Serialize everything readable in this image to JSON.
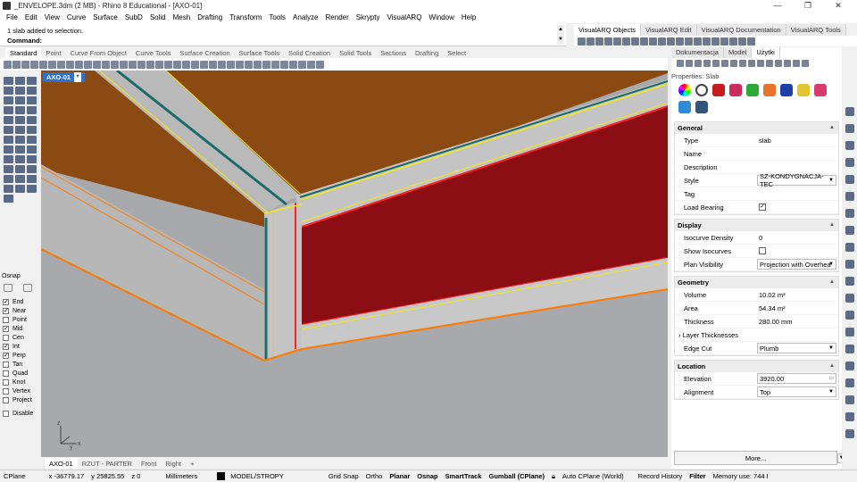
{
  "window": {
    "title": "_ENVELOPE.3dm (2 MB) - Rhino 8 Educational - [AXO-01]",
    "buttons": [
      "—",
      "❐",
      "✕"
    ]
  },
  "menu": [
    "File",
    "Edit",
    "View",
    "Curve",
    "Surface",
    "SubD",
    "Solid",
    "Mesh",
    "Drafting",
    "Transform",
    "Tools",
    "Analyze",
    "Render",
    "Skrypty",
    "VisualARQ",
    "Window",
    "Help"
  ],
  "command": {
    "history": "1 slab added to selection.",
    "prompt": "Command:"
  },
  "right_top_tabs": [
    "VisualARQ Objects",
    "VisualARQ Edit",
    "VisualARQ Documentation",
    "VisualARQ Tools"
  ],
  "toolbar_tabs": [
    "Standard",
    "Point",
    "Curve From Object",
    "Curve Tools",
    "Surface Creation",
    "Surface Tools",
    "Solid Creation",
    "Solid Tools",
    "Sections",
    "Drafting",
    "Select"
  ],
  "viewport": {
    "label": "AXO-01",
    "tabs": [
      "AXO-01",
      "RZUT - PARTER",
      "Front",
      "Right",
      "+"
    ],
    "axes": {
      "x": "x",
      "y": "y",
      "z": "z"
    }
  },
  "osnap": {
    "title": "Osnap",
    "items": [
      {
        "label": "End",
        "checked": true
      },
      {
        "label": "Near",
        "checked": true
      },
      {
        "label": "Point",
        "checked": false
      },
      {
        "label": "Mid",
        "checked": true
      },
      {
        "label": "Cen",
        "checked": false
      },
      {
        "label": "Int",
        "checked": true
      },
      {
        "label": "Perp",
        "checked": true
      },
      {
        "label": "Tan",
        "checked": false
      },
      {
        "label": "Quad",
        "checked": false
      },
      {
        "label": "Knot",
        "checked": false
      },
      {
        "label": "Vertex",
        "checked": false
      },
      {
        "label": "Project",
        "checked": false
      }
    ],
    "disable": "Disable"
  },
  "panel": {
    "tabs": [
      "Dokumentacja",
      "Model",
      "Użytki"
    ],
    "title": "Properties: Slab",
    "general": {
      "title": "General",
      "rows": [
        {
          "label": "Type",
          "value": "slab"
        },
        {
          "label": "Name",
          "value": ""
        },
        {
          "label": "Description",
          "value": ""
        },
        {
          "label": "Style",
          "value": "SZ-KONDYGNACJA-TEC"
        },
        {
          "label": "Tag",
          "value": ""
        },
        {
          "label": "Load Bearing",
          "value": "✓"
        }
      ]
    },
    "display": {
      "title": "Display",
      "rows": [
        {
          "label": "Isocurve Density",
          "value": "0"
        },
        {
          "label": "Show Isocurves",
          "value": ""
        },
        {
          "label": "Plan Visibility",
          "value": "Projection with Overhea"
        }
      ]
    },
    "geometry": {
      "title": "Geometry",
      "rows": [
        {
          "label": "Volume",
          "value": "10.02 m³"
        },
        {
          "label": "Area",
          "value": "54.34 m²"
        },
        {
          "label": "Thickness",
          "value": "280.00 mm"
        },
        {
          "label": "Layer Thicknesses",
          "value": ""
        },
        {
          "label": "Edge Cut",
          "value": "Plumb"
        }
      ]
    },
    "location": {
      "title": "Location",
      "rows": [
        {
          "label": "Elevation",
          "value": "3920.00"
        },
        {
          "label": "Alignment",
          "value": "Top"
        }
      ]
    },
    "more": "More..."
  },
  "status": {
    "cplane": "CPlane",
    "x": "x -36779.17",
    "y": "y 25825.55",
    "z": "z 0",
    "units": "Millimeters",
    "layer": "MODEL/STROPY",
    "toggles": [
      "Grid Snap",
      "Ortho",
      "Planar",
      "Osnap",
      "SmartTrack",
      "Gumball (CPlane)"
    ],
    "auto_cplane": "Auto CPlane (World)",
    "record": "Record History",
    "filter": "Filter",
    "memory": "Memory use: 744 I"
  },
  "colors": {
    "wood": "#8b4a12",
    "red_wall": "#8a0e14",
    "concrete": "#c4c4c4",
    "teal": "#1c6a6a",
    "highlight_yellow": "#f5e617",
    "accent_blue": "#2f73c8"
  }
}
